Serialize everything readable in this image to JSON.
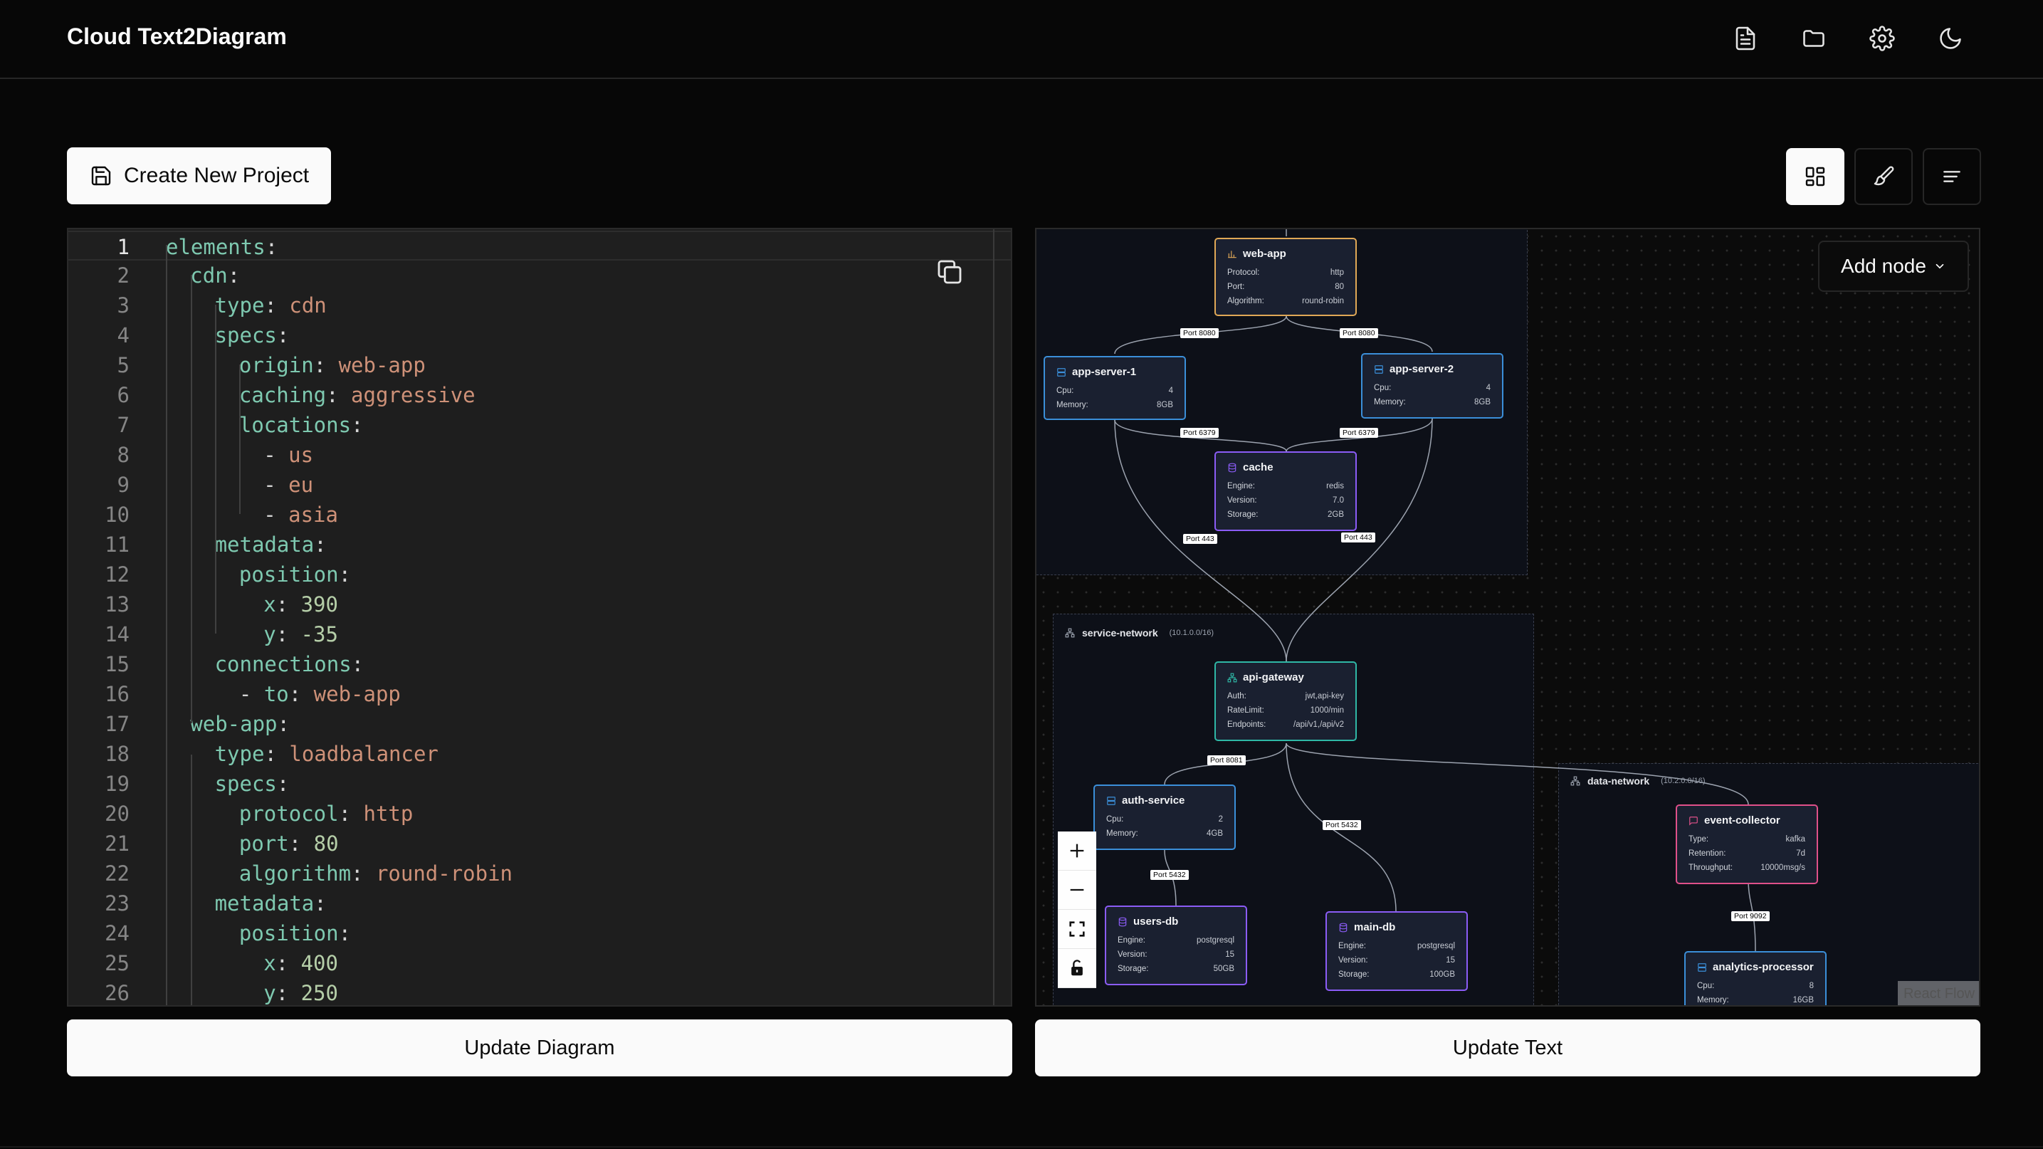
{
  "header": {
    "title": "Cloud Text2Diagram"
  },
  "toolbar": {
    "create_project_label": "Create New Project"
  },
  "editor": {
    "current_line": 1,
    "lines": [
      [
        [
          "k",
          "elements"
        ],
        [
          "p",
          ":"
        ]
      ],
      [
        [
          "k",
          "cdn"
        ],
        [
          "p",
          ":"
        ]
      ],
      [
        [
          "k",
          "type"
        ],
        [
          "p",
          ": "
        ],
        [
          "v",
          "cdn"
        ]
      ],
      [
        [
          "k",
          "specs"
        ],
        [
          "p",
          ":"
        ]
      ],
      [
        [
          "k",
          "origin"
        ],
        [
          "p",
          ": "
        ],
        [
          "v",
          "web-app"
        ]
      ],
      [
        [
          "k",
          "caching"
        ],
        [
          "p",
          ": "
        ],
        [
          "v",
          "aggressive"
        ]
      ],
      [
        [
          "k",
          "locations"
        ],
        [
          "p",
          ":"
        ]
      ],
      [
        [
          "p",
          "- "
        ],
        [
          "v",
          "us"
        ]
      ],
      [
        [
          "p",
          "- "
        ],
        [
          "v",
          "eu"
        ]
      ],
      [
        [
          "p",
          "- "
        ],
        [
          "v",
          "asia"
        ]
      ],
      [
        [
          "k",
          "metadata"
        ],
        [
          "p",
          ":"
        ]
      ],
      [
        [
          "k",
          "position"
        ],
        [
          "p",
          ":"
        ]
      ],
      [
        [
          "k",
          "x"
        ],
        [
          "p",
          ": "
        ],
        [
          "n",
          "390"
        ]
      ],
      [
        [
          "k",
          "y"
        ],
        [
          "p",
          ": "
        ],
        [
          "n",
          "-35"
        ]
      ],
      [
        [
          "k",
          "connections"
        ],
        [
          "p",
          ":"
        ]
      ],
      [
        [
          "p",
          "- "
        ],
        [
          "k",
          "to"
        ],
        [
          "p",
          ": "
        ],
        [
          "v",
          "web-app"
        ]
      ],
      [
        [
          "k",
          "web-app"
        ],
        [
          "p",
          ":"
        ]
      ],
      [
        [
          "k",
          "type"
        ],
        [
          "p",
          ": "
        ],
        [
          "v",
          "loadbalancer"
        ]
      ],
      [
        [
          "k",
          "specs"
        ],
        [
          "p",
          ":"
        ]
      ],
      [
        [
          "k",
          "protocol"
        ],
        [
          "p",
          ": "
        ],
        [
          "v",
          "http"
        ]
      ],
      [
        [
          "k",
          "port"
        ],
        [
          "p",
          ": "
        ],
        [
          "n",
          "80"
        ]
      ],
      [
        [
          "k",
          "algorithm"
        ],
        [
          "p",
          ": "
        ],
        [
          "v",
          "round-robin"
        ]
      ],
      [
        [
          "k",
          "metadata"
        ],
        [
          "p",
          ":"
        ]
      ],
      [
        [
          "k",
          "position"
        ],
        [
          "p",
          ":"
        ]
      ],
      [
        [
          "k",
          "x"
        ],
        [
          "p",
          ": "
        ],
        [
          "n",
          "400"
        ]
      ],
      [
        [
          "k",
          "y"
        ],
        [
          "p",
          ": "
        ],
        [
          "n",
          "250"
        ]
      ]
    ]
  },
  "diagram": {
    "add_node_label": "Add node",
    "attribution": "React Flow",
    "groups": [
      {
        "name": "service-network",
        "cidr": "(10.1.0.0/16)"
      },
      {
        "name": "data-network",
        "cidr": "(10.2.0.0/16)"
      }
    ],
    "nodes": [
      {
        "id": "web-app",
        "title": "web-app",
        "color": "#e0a856",
        "icon": "chart-icon",
        "rows": [
          [
            "Protocol:",
            "http"
          ],
          [
            "Port:",
            "80"
          ],
          [
            "Algorithm:",
            "round-robin"
          ]
        ]
      },
      {
        "id": "app-server-1",
        "title": "app-server-1",
        "color": "#3b8fd9",
        "icon": "server-icon",
        "rows": [
          [
            "Cpu:",
            "4"
          ],
          [
            "Memory:",
            "8GB"
          ]
        ]
      },
      {
        "id": "app-server-2",
        "title": "app-server-2",
        "color": "#3b8fd9",
        "icon": "server-icon",
        "rows": [
          [
            "Cpu:",
            "4"
          ],
          [
            "Memory:",
            "8GB"
          ]
        ]
      },
      {
        "id": "cache",
        "title": "cache",
        "color": "#8b5cf6",
        "icon": "database-icon",
        "rows": [
          [
            "Engine:",
            "redis"
          ],
          [
            "Version:",
            "7.0"
          ],
          [
            "Storage:",
            "2GB"
          ]
        ]
      },
      {
        "id": "api-gateway",
        "title": "api-gateway",
        "color": "#2fb8a6",
        "icon": "gateway-icon",
        "rows": [
          [
            "Auth:",
            "jwt,api-key"
          ],
          [
            "RateLimit:",
            "1000/min"
          ],
          [
            "Endpoints:",
            "/api/v1,/api/v2"
          ]
        ]
      },
      {
        "id": "auth-service",
        "title": "auth-service",
        "color": "#3b8fd9",
        "icon": "server-icon",
        "rows": [
          [
            "Cpu:",
            "2"
          ],
          [
            "Memory:",
            "4GB"
          ]
        ]
      },
      {
        "id": "users-db",
        "title": "users-db",
        "color": "#8b5cf6",
        "icon": "database-icon",
        "rows": [
          [
            "Engine:",
            "postgresql"
          ],
          [
            "Version:",
            "15"
          ],
          [
            "Storage:",
            "50GB"
          ]
        ]
      },
      {
        "id": "main-db",
        "title": "main-db",
        "color": "#8b5cf6",
        "icon": "database-icon",
        "rows": [
          [
            "Engine:",
            "postgresql"
          ],
          [
            "Version:",
            "15"
          ],
          [
            "Storage:",
            "100GB"
          ]
        ]
      },
      {
        "id": "event-collector",
        "title": "event-collector",
        "color": "#e0508a",
        "icon": "message-icon",
        "rows": [
          [
            "Type:",
            "kafka"
          ],
          [
            "Retention:",
            "7d"
          ],
          [
            "Throughput:",
            "10000msg/s"
          ]
        ]
      },
      {
        "id": "analytics-processor",
        "title": "analytics-processor",
        "color": "#3b8fd9",
        "icon": "server-icon",
        "rows": [
          [
            "Cpu:",
            "8"
          ],
          [
            "Memory:",
            "16GB"
          ]
        ]
      }
    ],
    "port_labels": [
      "Port 8080",
      "Port 8080",
      "Port 6379",
      "Port 6379",
      "Port 443",
      "Port 443",
      "Port 8081",
      "Port 5432",
      "Port 5432",
      "Port 9092"
    ]
  },
  "actions": {
    "update_diagram_label": "Update Diagram",
    "update_text_label": "Update Text"
  }
}
